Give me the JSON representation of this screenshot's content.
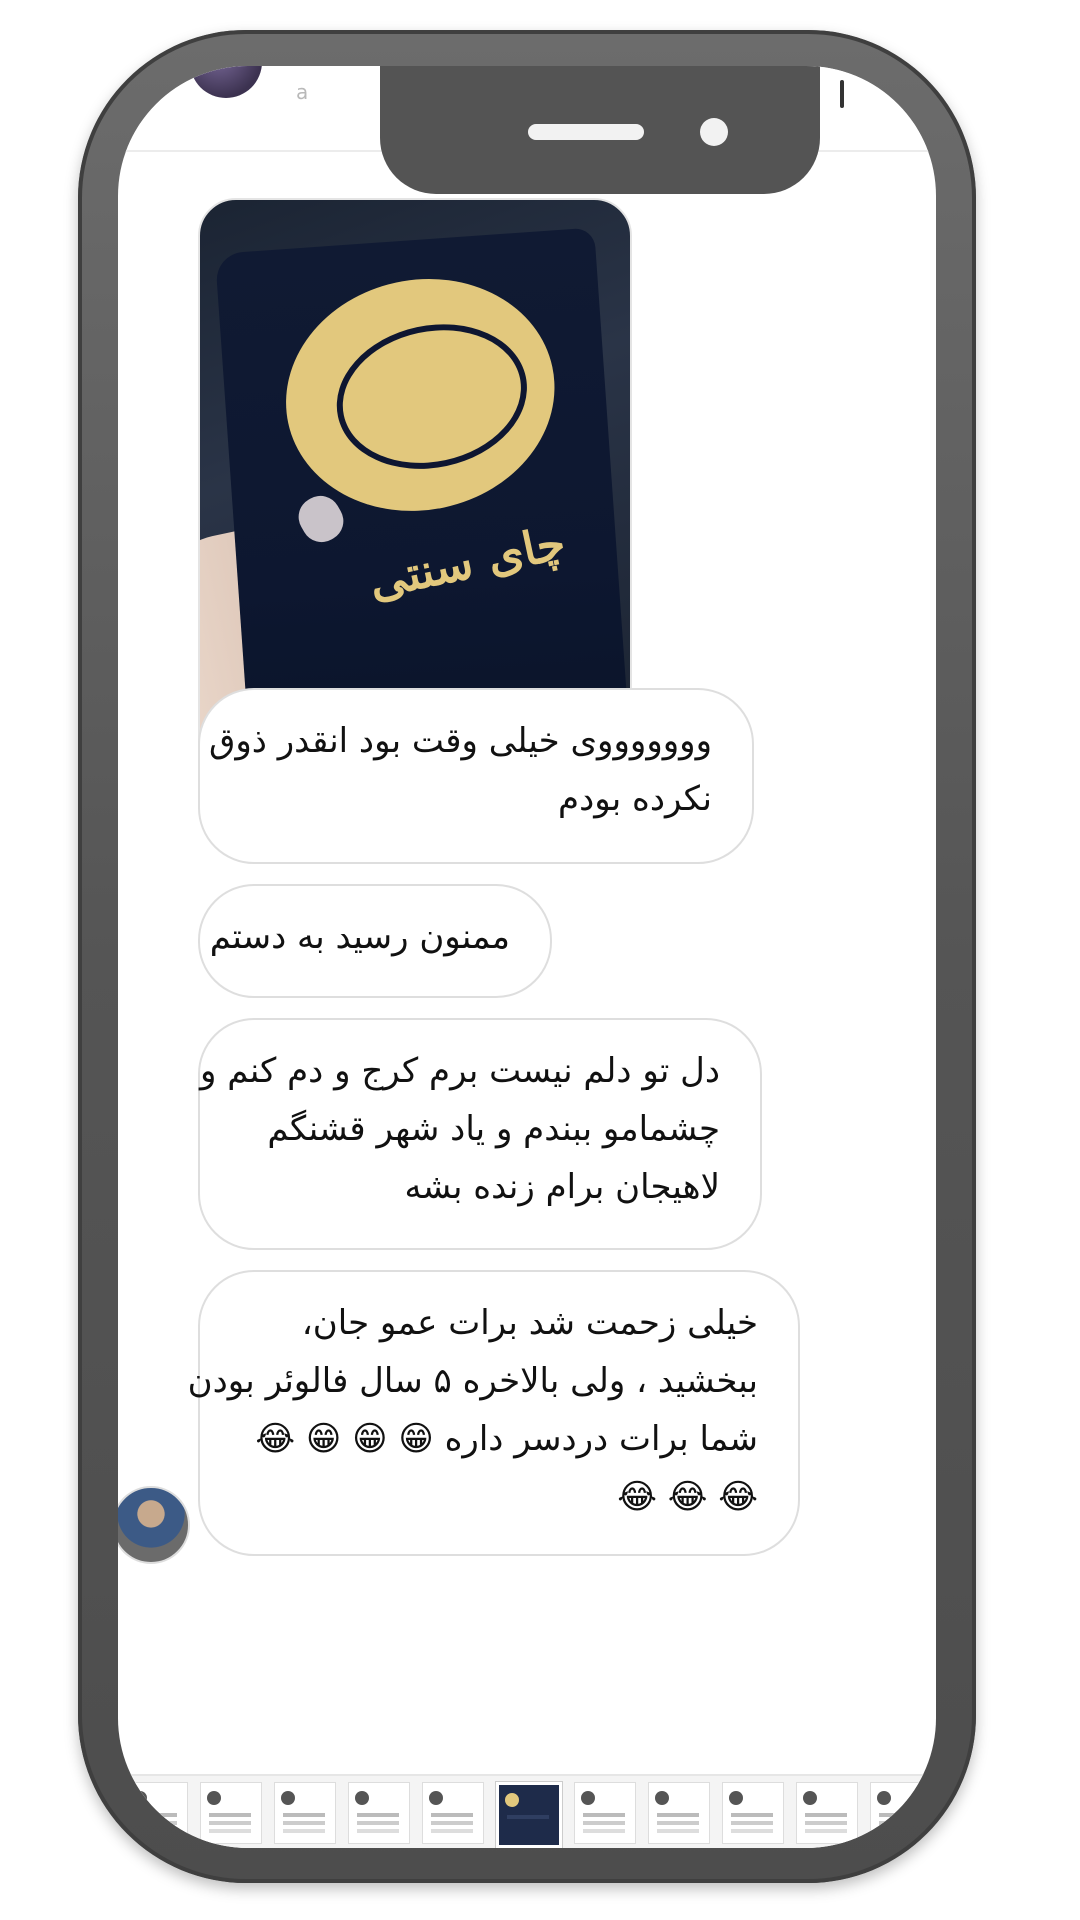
{
  "header": {
    "peek_letter": "a"
  },
  "messages": {
    "photo": {
      "alt": "چای سنتی لاهیجان"
    },
    "m1": [
      "وووووووی خیلی وقت بود انقدر ذوق",
      "نکرده بودم"
    ],
    "m2": [
      "ممنون رسید به دستم"
    ],
    "m3": [
      "دل تو دلم نیست برم کرج و دم کنم و",
      "چشمامو ببندم و یاد شهر قشنگم",
      "لاهیجان برام زنده بشه"
    ],
    "m4": [
      "خیلی زحمت شد برات عمو جان،",
      "ببخشید ، ولی بالاخره ۵ سال فالوئر بودن",
      "شما برات دردسر داره 😁 😁 😁 😂",
      "😂 😂 😂"
    ]
  },
  "photo_text": {
    "label": "چای سنتی"
  },
  "thumbnails": {
    "count": 11,
    "active_index": 5
  },
  "colors": {
    "frame": "#555555",
    "bubble_border": "#dedede",
    "bag_gold": "#e2c87d",
    "bag_navy": "#101a33"
  }
}
